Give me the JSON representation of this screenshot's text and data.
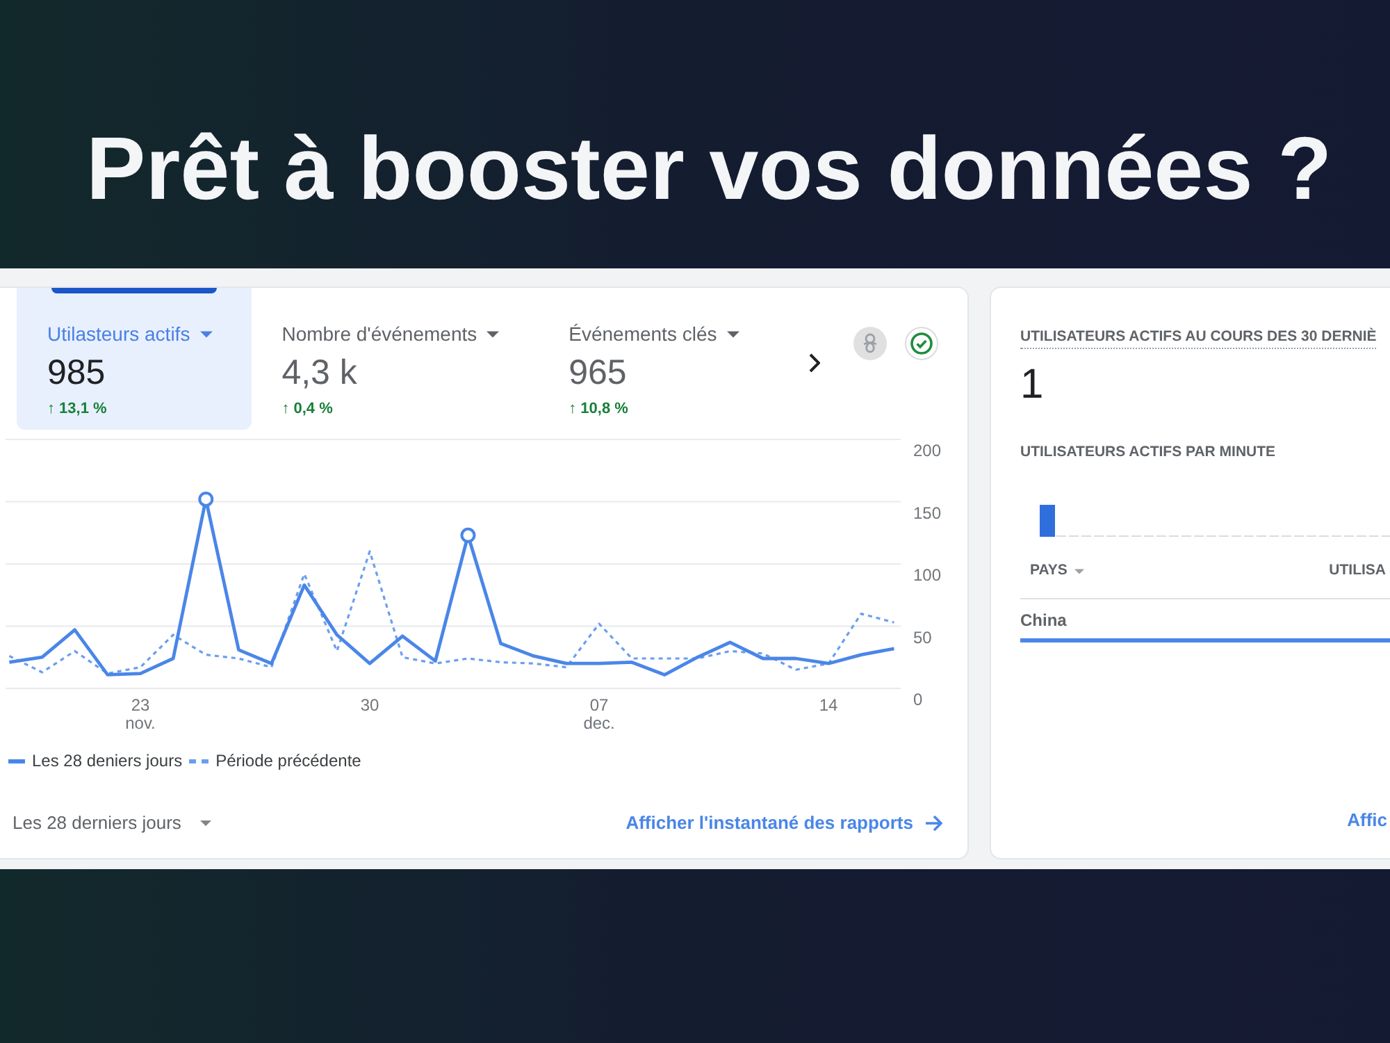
{
  "heading": "Prêt à booster vos données ?",
  "overview_card": {
    "tabs": [
      {
        "label": "Utilasteurs actifs",
        "value": "985",
        "change": "↑ 13,1 %",
        "selected": true
      },
      {
        "label": "Nombre d'événements",
        "value": "4,3 k",
        "change": "↑ 0,4 %",
        "selected": false
      },
      {
        "label": "Événements clés",
        "value": "965",
        "change": "↑ 10,8 %",
        "selected": false
      }
    ],
    "chart_data": {
      "type": "line",
      "categories": [
        null,
        null,
        null,
        null,
        "23 nov.",
        null,
        null,
        null,
        null,
        null,
        null,
        "30",
        null,
        null,
        null,
        null,
        null,
        null,
        "07 dec.",
        null,
        null,
        null,
        null,
        null,
        null,
        "14",
        null,
        null
      ],
      "ylim": [
        0,
        200
      ],
      "yticks": [
        0,
        50,
        100,
        150,
        200
      ],
      "grid": true,
      "series": [
        {
          "name": "Les 28 deniers jours",
          "color": "#4a86e8",
          "line_style": "solid",
          "values": [
            21,
            25,
            47,
            11,
            12,
            24,
            152,
            31,
            20,
            83,
            43,
            20,
            42,
            22,
            123,
            36,
            26,
            20,
            20,
            21,
            11,
            25,
            37,
            24,
            24,
            20,
            27,
            32
          ]
        },
        {
          "name": "Période précédente",
          "color": "#6b9ef0",
          "line_style": "dashed",
          "values": [
            26,
            13,
            30,
            12,
            17,
            43,
            27,
            24,
            17,
            92,
            30,
            110,
            25,
            20,
            24,
            21,
            20,
            17,
            52,
            24,
            24,
            24,
            30,
            28,
            15,
            20,
            60,
            53
          ]
        }
      ]
    },
    "range_selector": {
      "label": "Les 28 derniers jours"
    },
    "report_link": {
      "label": "Afficher l'instantané des rapports"
    }
  },
  "realtime_card": {
    "title": "UTILISATEURS ACTIFS AU COURS DES 30 DERNIÈ",
    "value": "1",
    "per_minute_title": "UTILISATEURS ACTIFS PAR MINUTE",
    "columns": [
      {
        "label": "PAYS",
        "dropdown": true
      },
      {
        "label": "UTILISA",
        "dropdown": false
      }
    ],
    "rows": [
      {
        "country": "China",
        "level": 1
      }
    ],
    "link": "Affic"
  }
}
